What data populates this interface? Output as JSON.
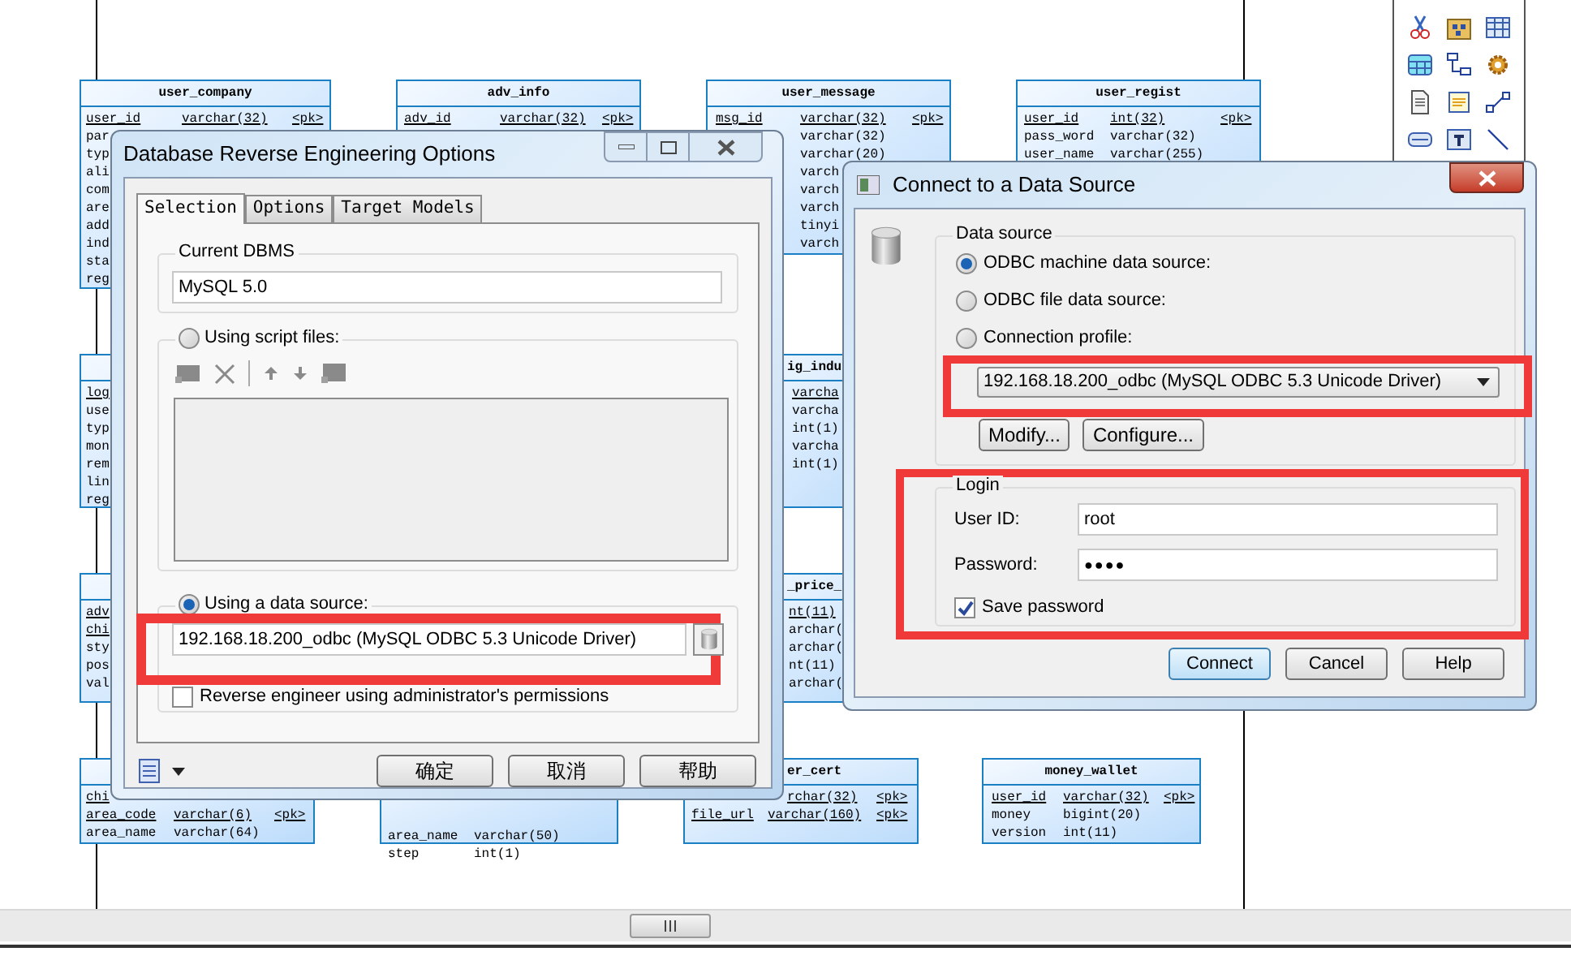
{
  "diagram": {
    "tables": [
      {
        "name": "user_company",
        "rows": [
          {
            "name": "user_id",
            "type": "varchar(32)",
            "pk": "<pk>",
            "key": true
          },
          {
            "name": "par",
            "key": false
          },
          {
            "name": "typ",
            "key": false
          },
          {
            "name": "ali",
            "key": false
          },
          {
            "name": "com",
            "key": false
          },
          {
            "name": "are",
            "key": false
          },
          {
            "name": "add",
            "key": false
          },
          {
            "name": "ind",
            "key": false
          },
          {
            "name": "sta",
            "key": false
          },
          {
            "name": "reg",
            "key": false
          }
        ]
      },
      {
        "name": "adv_info",
        "rows": [
          {
            "name": "adv_id",
            "type": "varchar(32)",
            "pk": "<pk>",
            "key": true
          }
        ]
      },
      {
        "name": "user_message",
        "rows": [
          {
            "name": "msg_id",
            "type": "varchar(32)",
            "pk": "<pk>",
            "key": true
          },
          {
            "type": "varchar(32)",
            "key": false
          },
          {
            "type": "varchar(20)",
            "key": false
          },
          {
            "type": "varch",
            "key": false
          },
          {
            "type": "varch",
            "key": false
          },
          {
            "type": "varch",
            "key": false
          },
          {
            "type": "tinyi",
            "key": false
          },
          {
            "type": "varch",
            "key": false
          }
        ]
      },
      {
        "name": "user_regist",
        "rows": [
          {
            "name": "user_id",
            "type": "int(32)",
            "pk": "<pk>",
            "key": true
          },
          {
            "name": "pass_word",
            "type": "varchar(32)",
            "key": false
          },
          {
            "name": "user_name",
            "type": "varchar(255)",
            "key": false
          }
        ]
      },
      {
        "rows": [
          {
            "name": "log",
            "key": true
          },
          {
            "name": "use",
            "key": false
          },
          {
            "name": "typ",
            "key": false
          },
          {
            "name": "mon",
            "key": false
          },
          {
            "name": "rem",
            "key": false
          },
          {
            "name": "lin",
            "key": false
          },
          {
            "name": "reg",
            "key": false
          }
        ]
      },
      {
        "name": "ig_indu",
        "rows": [
          {
            "type": "varcha",
            "key": true
          },
          {
            "type": "varcha",
            "key": false
          },
          {
            "type": "int(1)",
            "key": false
          },
          {
            "type": "varcha",
            "key": false
          },
          {
            "type": "int(1)",
            "key": false
          }
        ]
      },
      {
        "rows": [
          {
            "name": "adv",
            "key": true
          },
          {
            "name": "chi",
            "key": true
          },
          {
            "name": "sty",
            "key": false
          },
          {
            "name": "pos",
            "key": false
          },
          {
            "name": "val",
            "key": false
          }
        ]
      },
      {
        "name": "_price_",
        "rows": [
          {
            "type": "nt(11)",
            "key": true
          },
          {
            "type": "archar(",
            "key": false
          },
          {
            "type": "archar(",
            "key": false
          },
          {
            "type": "nt(11)",
            "key": false
          },
          {
            "type": "archar(",
            "key": false
          }
        ]
      },
      {
        "rows": [
          {
            "name": "chi",
            "key": true
          },
          {
            "name": "area_code",
            "type": "varchar(6)",
            "pk": "<pk>",
            "key": true
          },
          {
            "name": "area_name",
            "type": "varchar(64)",
            "key": false
          }
        ]
      },
      {
        "rows": [
          {
            "name": "area_name",
            "type": "varchar(50)",
            "key": false
          },
          {
            "name": "step",
            "type": "int(1)",
            "key": false
          }
        ]
      },
      {
        "name": "er_cert",
        "rows": [
          {
            "type": "rchar(32)",
            "pk": "<pk>",
            "key": true
          },
          {
            "name": "file_url",
            "type": "varchar(160)",
            "pk": "<pk>",
            "key": true
          }
        ]
      },
      {
        "name": "money_wallet",
        "rows": [
          {
            "name": "user_id",
            "type": "varchar(32)",
            "pk": "<pk>",
            "key": true
          },
          {
            "name": "money",
            "type": "bigint(20)",
            "key": false
          },
          {
            "name": "version",
            "type": "int(11)",
            "key": false
          }
        ]
      }
    ]
  },
  "reverse_dialog": {
    "title": "Database Reverse Engineering Options",
    "tabs": [
      {
        "label": "Selection",
        "selected": true
      },
      {
        "label": "Options",
        "selected": false
      },
      {
        "label": "Target Models",
        "selected": false
      }
    ],
    "dbms_group": "Current DBMS",
    "dbms_value": "MySQL 5.0",
    "sources": [
      {
        "label": "Using script files:",
        "selected": false
      },
      {
        "label": "Using a data source:",
        "selected": true
      }
    ],
    "data_source_value": "192.168.18.200_odbc (MySQL ODBC 5.3 Unicode Driver)",
    "admin_checkbox": {
      "label": "Reverse engineer using administrator's permissions",
      "checked": false
    },
    "buttons": [
      "确定",
      "取消",
      "帮助"
    ]
  },
  "connect_dialog": {
    "title": "Connect to a Data Source",
    "source_group": "Data source",
    "options": [
      {
        "label": "ODBC machine data source:",
        "selected": true
      },
      {
        "label": "ODBC file data source:",
        "selected": false
      },
      {
        "label": "Connection profile:",
        "selected": false
      }
    ],
    "profile_value": "192.168.18.200_odbc (MySQL ODBC 5.3 Unicode Driver)",
    "profile_buttons": [
      "Modify...",
      "Configure..."
    ],
    "login_group": "Login",
    "fields": [
      {
        "label": "User ID:",
        "value": "root",
        "kind": "text"
      },
      {
        "label": "Password:",
        "value": "●●●●",
        "kind": "password"
      }
    ],
    "save_password": {
      "label": "Save password",
      "checked": true
    },
    "buttons": [
      {
        "label": "Connect",
        "selected": true
      },
      {
        "label": "Cancel",
        "selected": false
      },
      {
        "label": "Help",
        "selected": false
      }
    ]
  }
}
